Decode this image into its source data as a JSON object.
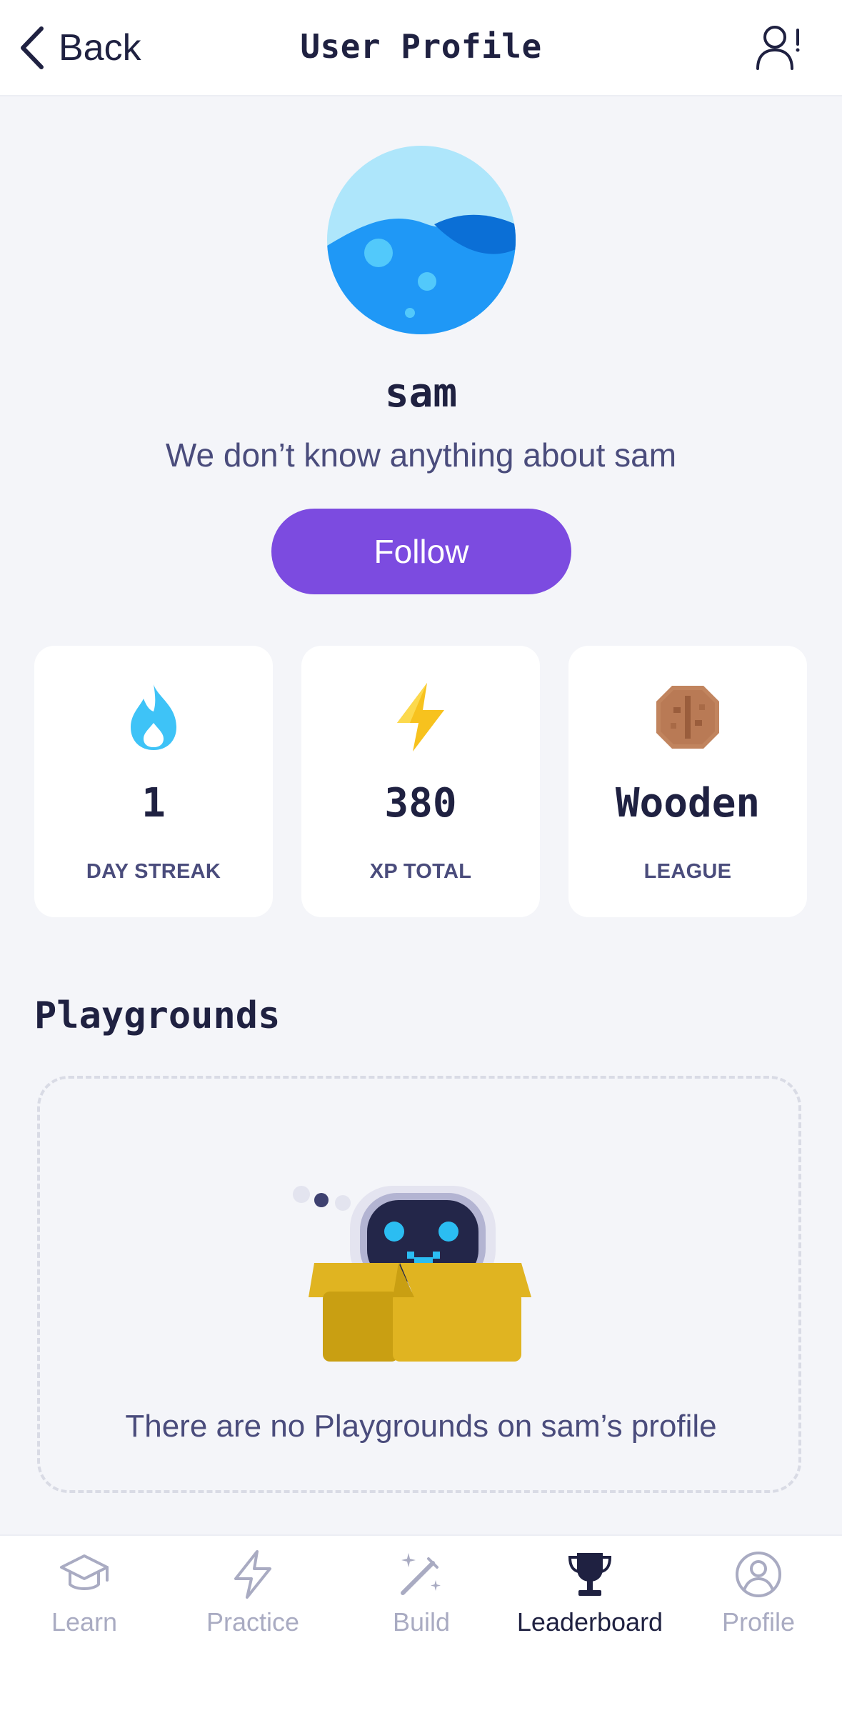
{
  "header": {
    "back_label": "Back",
    "title": "User Profile",
    "report_icon": "user-report-icon"
  },
  "profile": {
    "username": "sam",
    "bio": "We don’t know anything about sam",
    "follow_label": "Follow",
    "avatar_icon": "water-avatar"
  },
  "stats": [
    {
      "icon": "flame-icon",
      "value": "1",
      "label": "DAY STREAK",
      "color": "#3ec3f7"
    },
    {
      "icon": "lightning-icon",
      "value": "380",
      "label": "XP TOTAL",
      "color": "#f7c21e"
    },
    {
      "icon": "wooden-league-icon",
      "value": "Wooden",
      "label": "LEAGUE",
      "color": "#c1845e"
    }
  ],
  "playgrounds": {
    "title": "Playgrounds",
    "empty_text": "There are no Playgrounds on sam’s profile"
  },
  "nav": {
    "items": [
      {
        "label": "Learn",
        "icon": "graduation-cap-icon",
        "active": false
      },
      {
        "label": "Practice",
        "icon": "lightning-icon",
        "active": false
      },
      {
        "label": "Build",
        "icon": "magic-wand-icon",
        "active": false
      },
      {
        "label": "Leaderboard",
        "icon": "trophy-icon",
        "active": true
      },
      {
        "label": "Profile",
        "icon": "user-circle-icon",
        "active": false
      }
    ]
  },
  "colors": {
    "accent": "#7c4be0",
    "background": "#f4f5f9",
    "text": "#1f2141",
    "muted": "#a9abc2"
  }
}
